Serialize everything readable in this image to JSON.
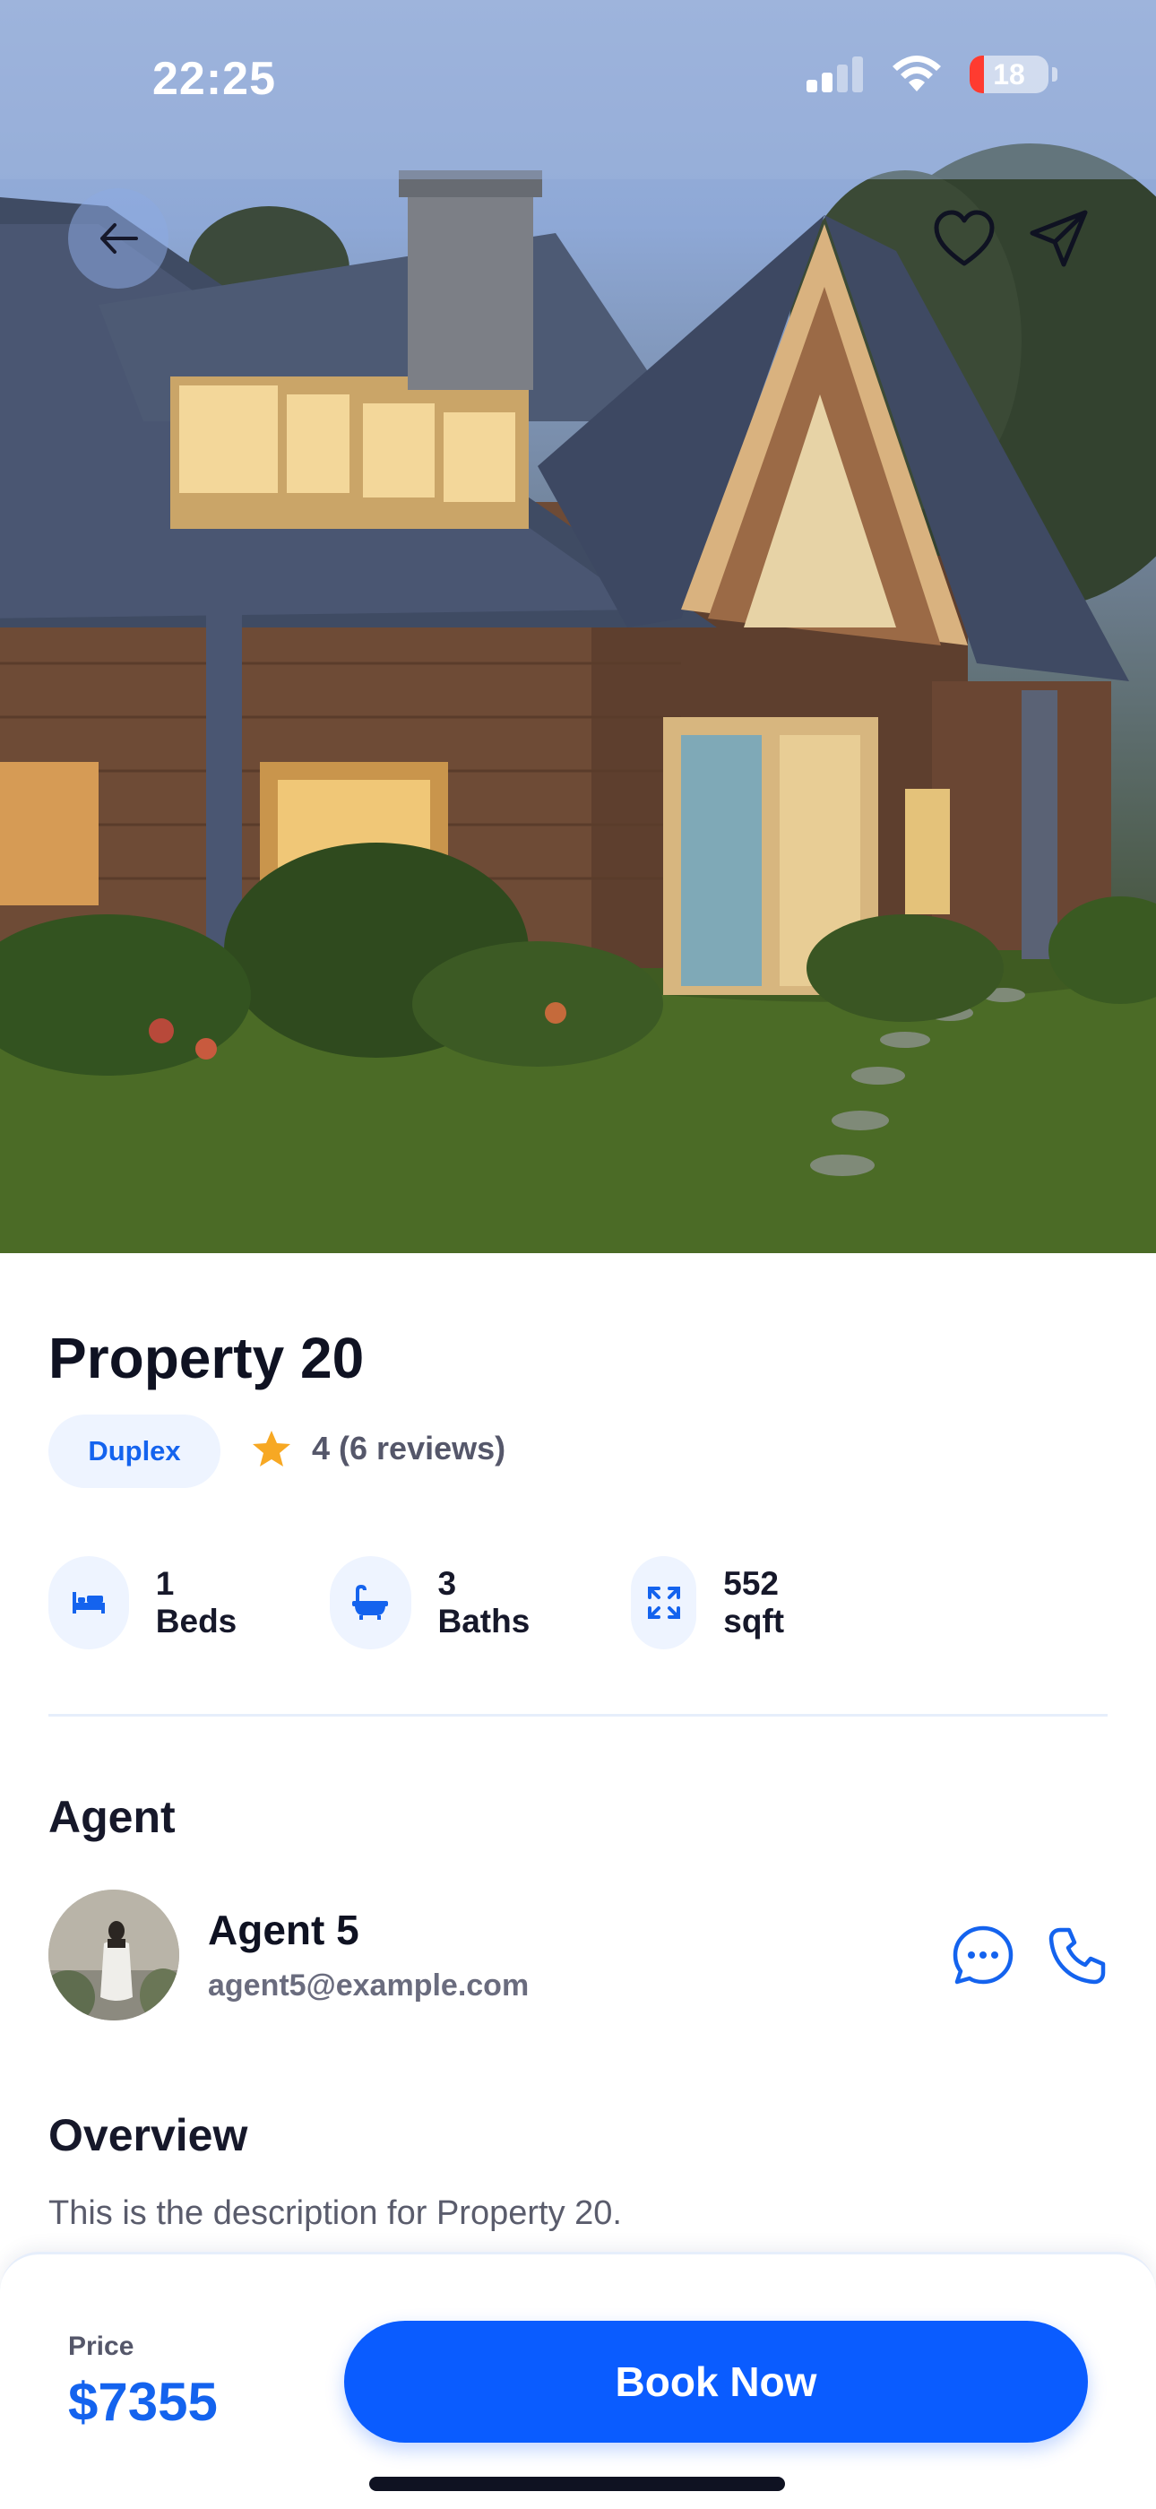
{
  "status_bar": {
    "time": "22:25",
    "battery": "18",
    "battery_level": 0.18
  },
  "hero": {
    "image": "house-exterior-photo"
  },
  "property": {
    "title": "Property 20",
    "type": "Duplex",
    "rating": "4 (6 reviews)",
    "features": [
      {
        "icon": "bed-icon",
        "label": "1 Beds"
      },
      {
        "icon": "bathtub-icon",
        "label": "3 Baths"
      },
      {
        "icon": "expand-icon",
        "label": "552 sqft"
      }
    ]
  },
  "agent": {
    "section_title": "Agent",
    "name": "Agent 5",
    "email": "agent5@example.com"
  },
  "overview": {
    "section_title": "Overview",
    "description": "This is the description for Property 20."
  },
  "footer": {
    "price_label": "Price",
    "price": "$7355",
    "book_label": "Book Now"
  },
  "colors": {
    "accent": "#0a5cff",
    "badge_bg": "#eef4ff",
    "star": "#f7a823"
  }
}
